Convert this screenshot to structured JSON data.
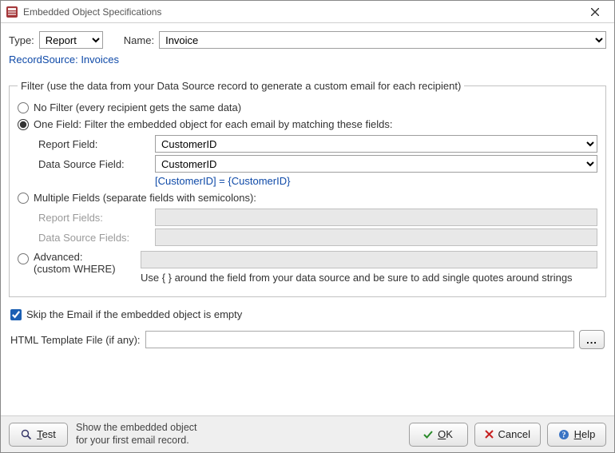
{
  "window": {
    "title": "Embedded Object Specifications"
  },
  "header": {
    "type_label": "Type:",
    "type_value": "Report",
    "name_label": "Name:",
    "name_value": "Invoice",
    "record_source": "RecordSource: Invoices"
  },
  "filter": {
    "legend": "Filter (use the data from your Data Source record to generate a custom email for each recipient)",
    "selected": "one_field",
    "no_filter_label": "No Filter (every recipient gets the same data)",
    "one_field_label": "One Field: Filter the embedded object for each email by matching these fields:",
    "one_field": {
      "report_field_label": "Report Field:",
      "report_field_value": "CustomerID",
      "data_source_field_label": "Data Source Field:",
      "data_source_field_value": "CustomerID",
      "formula": "[CustomerID] = {CustomerID}"
    },
    "multiple_fields_label": "Multiple Fields (separate fields with semicolons):",
    "multiple_fields": {
      "report_fields_label": "Report Fields:",
      "report_fields_value": "",
      "data_source_fields_label": "Data Source Fields:",
      "data_source_fields_value": ""
    },
    "advanced_label_line1": "Advanced:",
    "advanced_label_line2": "(custom WHERE)",
    "advanced": {
      "where_value": "",
      "hint": "Use { } around the field from your data source and be sure to add single quotes around strings"
    }
  },
  "skip": {
    "checked": true,
    "label": "Skip the Email if the embedded object is empty"
  },
  "template": {
    "label": "HTML Template File (if any):",
    "value": "",
    "browse_label": "..."
  },
  "footer": {
    "test_label": "Test",
    "message_line1": "Show the embedded object",
    "message_line2": "for your first email record.",
    "ok_label": "OK",
    "cancel_label": "Cancel",
    "help_label": "Help"
  }
}
